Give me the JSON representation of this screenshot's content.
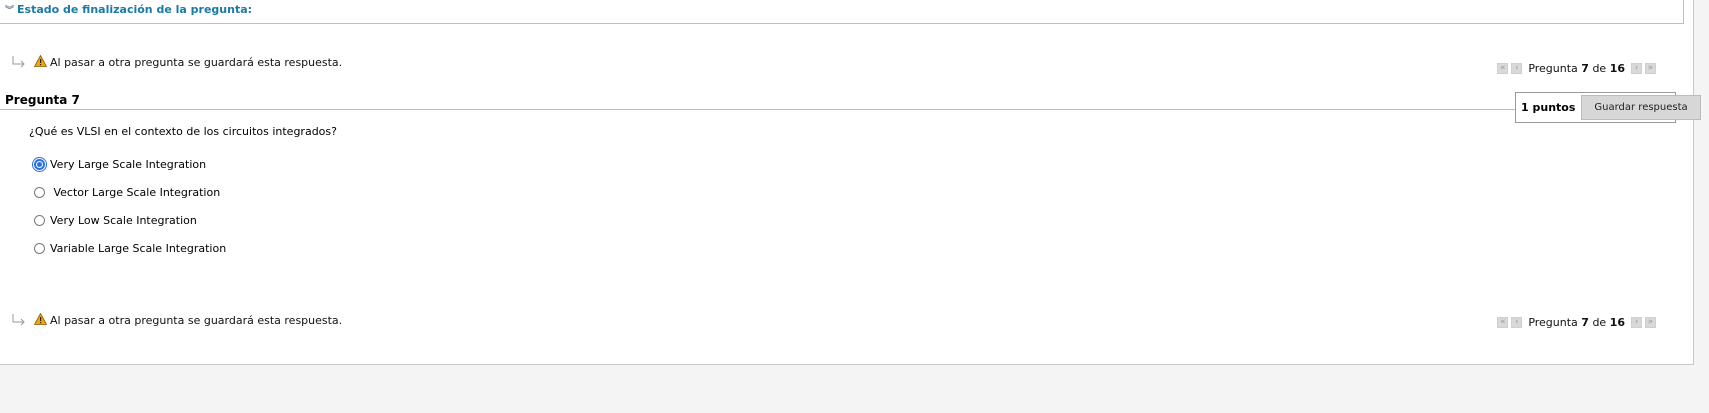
{
  "status": {
    "label": "Estado de finalización de la pregunta:",
    "chevron_icon": "double-chevron-down-icon"
  },
  "warning": {
    "text": "Al pasar a otra pregunta se guardará esta respuesta.",
    "icon": "warning-icon",
    "warning_color": "#f2a800"
  },
  "nav": {
    "prefix": "Pregunta",
    "current": "7",
    "middle": "de",
    "total": "16",
    "first_icon": "«",
    "prev_icon": "‹",
    "next_icon": "›",
    "last_icon": "»"
  },
  "question": {
    "title": "Pregunta 7",
    "points": "1 puntos",
    "save_label": "Guardar respuesta",
    "text": "¿Qué es VLSI en el contexto de los circuitos integrados?",
    "options": [
      {
        "label": "Very Large Scale Integration",
        "selected": true
      },
      {
        "label": " Vector Large Scale Integration",
        "selected": false
      },
      {
        "label": "Very Low Scale Integration",
        "selected": false
      },
      {
        "label": "Variable Large Scale Integration",
        "selected": false
      }
    ]
  },
  "colors": {
    "link": "#1a7aa5",
    "selected_radio": "#2a6fe0"
  }
}
